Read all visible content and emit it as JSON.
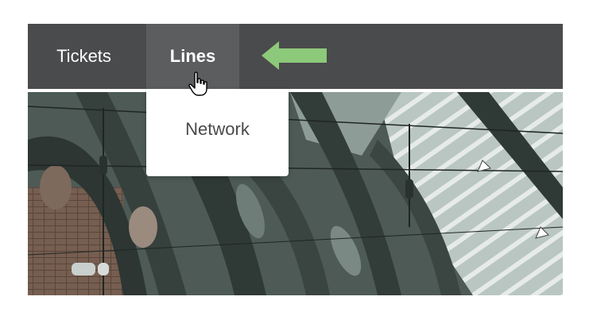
{
  "nav": {
    "items": [
      {
        "label": "Tickets"
      },
      {
        "label": "Lines",
        "active": true
      }
    ]
  },
  "dropdown": {
    "items": [
      {
        "label": "Network"
      }
    ]
  },
  "annotation": {
    "arrow_icon": "left-arrow-icon",
    "arrow_color": "#8cc97a"
  },
  "cursor": {
    "icon": "hand-pointer-icon"
  },
  "hero": {
    "image": "train-station-roof-photo"
  },
  "colors": {
    "navbar_bg": "#4a4b4c",
    "nav_active_bg": "#5c5d5e",
    "nav_text": "#ffffff",
    "dropdown_text": "#4a4a4a"
  }
}
